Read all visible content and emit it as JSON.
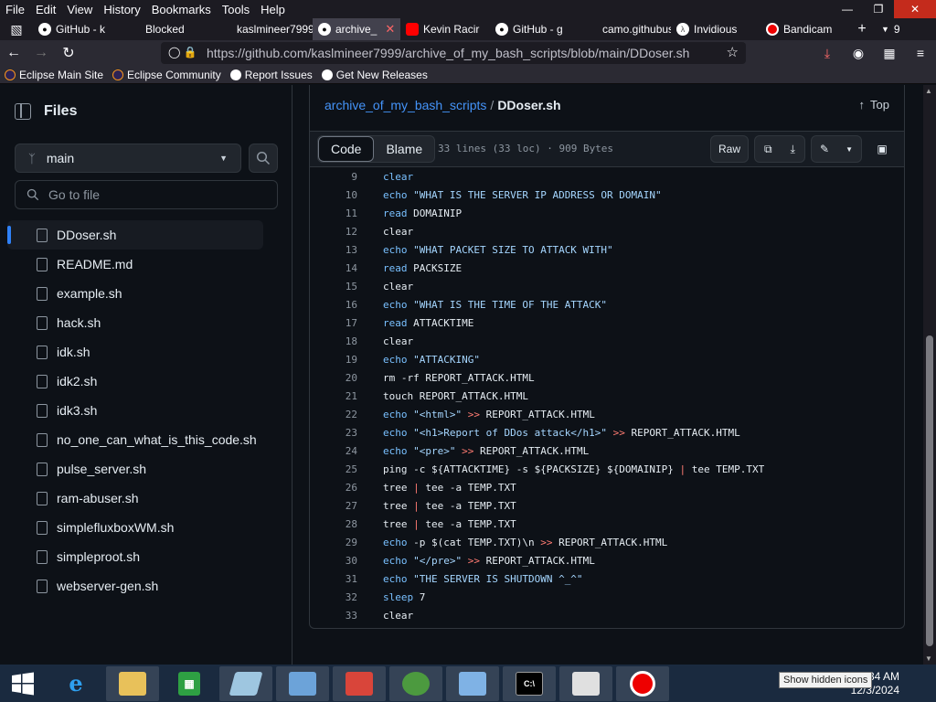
{
  "menubar": {
    "items": [
      "File",
      "Edit",
      "View",
      "History",
      "Bookmarks",
      "Tools",
      "Help"
    ]
  },
  "tabs": [
    {
      "label": "GitHub - k",
      "icon": "github-icon"
    },
    {
      "label": "Blocked",
      "icon": "blank-icon"
    },
    {
      "label": "kaslmineer7999",
      "icon": "blank-icon"
    },
    {
      "label": "archive_",
      "icon": "github-icon",
      "active": true
    },
    {
      "label": "Kevin Racir",
      "icon": "youtube-icon"
    },
    {
      "label": "GitHub - g",
      "icon": "github-icon"
    },
    {
      "label": "camo.githubus",
      "icon": "blank-icon"
    },
    {
      "label": "Invidious",
      "icon": "invidious-icon"
    },
    {
      "label": "Bandicam",
      "icon": "bandicam-icon"
    }
  ],
  "tab_overflow_count": "9",
  "navbar": {
    "url": "https://github.com/kaslmineer7999/archive_of_my_bash_scripts/blob/main/DDoser.sh"
  },
  "bookmarks": [
    "Eclipse Main Site",
    "Eclipse Community",
    "Report Issues",
    "Get New Releases"
  ],
  "sidebar": {
    "title": "Files",
    "branch": "main",
    "goto_placeholder": "Go to file",
    "files": [
      "DDoser.sh",
      "README.md",
      "example.sh",
      "hack.sh",
      "idk.sh",
      "idk2.sh",
      "idk3.sh",
      "no_one_can_what_is_this_code.sh",
      "pulse_server.sh",
      "ram-abuser.sh",
      "simplefluxboxWM.sh",
      "simpleproot.sh",
      "webserver-gen.sh"
    ],
    "selected": "DDoser.sh"
  },
  "file_header": {
    "repo": "archive_of_my_bash_scripts",
    "separator": "/",
    "filename": "DDoser.sh",
    "top_label": "Top"
  },
  "toolbar": {
    "code_label": "Code",
    "blame_label": "Blame",
    "meta": "33 lines (33 loc) · 909 Bytes",
    "raw_label": "Raw"
  },
  "code_lines": [
    {
      "n": "9",
      "segs": [
        [
          "kw",
          "clear"
        ]
      ]
    },
    {
      "n": "10",
      "segs": [
        [
          "kw",
          "echo "
        ],
        [
          "str",
          "\"WHAT IS THE SERVER IP ADDRESS OR DOMAIN\""
        ]
      ]
    },
    {
      "n": "11",
      "segs": [
        [
          "kw",
          "read "
        ],
        [
          "",
          "DOMAINIP"
        ]
      ]
    },
    {
      "n": "12",
      "segs": [
        [
          "",
          "clear"
        ]
      ]
    },
    {
      "n": "13",
      "segs": [
        [
          "kw",
          "echo "
        ],
        [
          "str",
          "\"WHAT PACKET SIZE TO ATTACK WITH\""
        ]
      ]
    },
    {
      "n": "14",
      "segs": [
        [
          "kw",
          "read "
        ],
        [
          "",
          "PACKSIZE"
        ]
      ]
    },
    {
      "n": "15",
      "segs": [
        [
          "",
          "clear"
        ]
      ]
    },
    {
      "n": "16",
      "segs": [
        [
          "kw",
          "echo "
        ],
        [
          "str",
          "\"WHAT IS THE TIME OF THE ATTACK\""
        ]
      ]
    },
    {
      "n": "17",
      "segs": [
        [
          "kw",
          "read "
        ],
        [
          "",
          "ATTACKTIME"
        ]
      ]
    },
    {
      "n": "18",
      "segs": [
        [
          "",
          "clear"
        ]
      ]
    },
    {
      "n": "19",
      "segs": [
        [
          "kw",
          "echo "
        ],
        [
          "str",
          "\"ATTACKING\""
        ]
      ]
    },
    {
      "n": "20",
      "segs": [
        [
          "",
          "rm -rf REPORT_ATTACK.HTML"
        ]
      ]
    },
    {
      "n": "21",
      "segs": [
        [
          "",
          "touch REPORT_ATTACK.HTML"
        ]
      ]
    },
    {
      "n": "22",
      "segs": [
        [
          "kw",
          "echo "
        ],
        [
          "str",
          "\"<html>\""
        ],
        [
          "op",
          " >> "
        ],
        [
          "",
          "REPORT_ATTACK.HTML"
        ]
      ]
    },
    {
      "n": "23",
      "segs": [
        [
          "kw",
          "echo "
        ],
        [
          "str",
          "\"<h1>Report of DDos attack</h1>\""
        ],
        [
          "op",
          " >> "
        ],
        [
          "",
          "REPORT_ATTACK.HTML"
        ]
      ]
    },
    {
      "n": "24",
      "segs": [
        [
          "kw",
          "echo "
        ],
        [
          "str",
          "\"<pre>\""
        ],
        [
          "op",
          " >> "
        ],
        [
          "",
          "REPORT_ATTACK.HTML"
        ]
      ]
    },
    {
      "n": "25",
      "segs": [
        [
          "",
          "ping -c ${ATTACKTIME} -s ${PACKSIZE} ${DOMAINIP} "
        ],
        [
          "op",
          "| "
        ],
        [
          "",
          "tee TEMP.TXT"
        ]
      ]
    },
    {
      "n": "26",
      "segs": [
        [
          "",
          "tree "
        ],
        [
          "op",
          "| "
        ],
        [
          "",
          "tee -a TEMP.TXT"
        ]
      ]
    },
    {
      "n": "27",
      "segs": [
        [
          "",
          "tree "
        ],
        [
          "op",
          "| "
        ],
        [
          "",
          "tee -a TEMP.TXT"
        ]
      ]
    },
    {
      "n": "28",
      "segs": [
        [
          "",
          "tree "
        ],
        [
          "op",
          "| "
        ],
        [
          "",
          "tee -a TEMP.TXT"
        ]
      ]
    },
    {
      "n": "29",
      "segs": [
        [
          "kw",
          "echo "
        ],
        [
          "",
          "-p $(cat TEMP.TXT)\\n"
        ],
        [
          "op",
          " >> "
        ],
        [
          "",
          "REPORT_ATTACK.HTML"
        ]
      ]
    },
    {
      "n": "30",
      "segs": [
        [
          "kw",
          "echo "
        ],
        [
          "str",
          "\"</pre>\""
        ],
        [
          "op",
          " >> "
        ],
        [
          "",
          "REPORT_ATTACK.HTML"
        ]
      ]
    },
    {
      "n": "31",
      "segs": [
        [
          "kw",
          "echo "
        ],
        [
          "str",
          "\"THE SERVER IS SHUTDOWN ^_^\""
        ]
      ]
    },
    {
      "n": "32",
      "segs": [
        [
          "kw",
          "sleep "
        ],
        [
          "",
          "7"
        ]
      ]
    },
    {
      "n": "33",
      "segs": [
        [
          "",
          "clear"
        ]
      ]
    }
  ],
  "taskbar": {
    "clock_time": ":34 AM",
    "clock_date": "12/3/2024",
    "tooltip": "Show hidden icons"
  },
  "colors": {
    "accent": "#2f81f7",
    "link": "#4493f8",
    "page_bg": "#0d1117"
  }
}
